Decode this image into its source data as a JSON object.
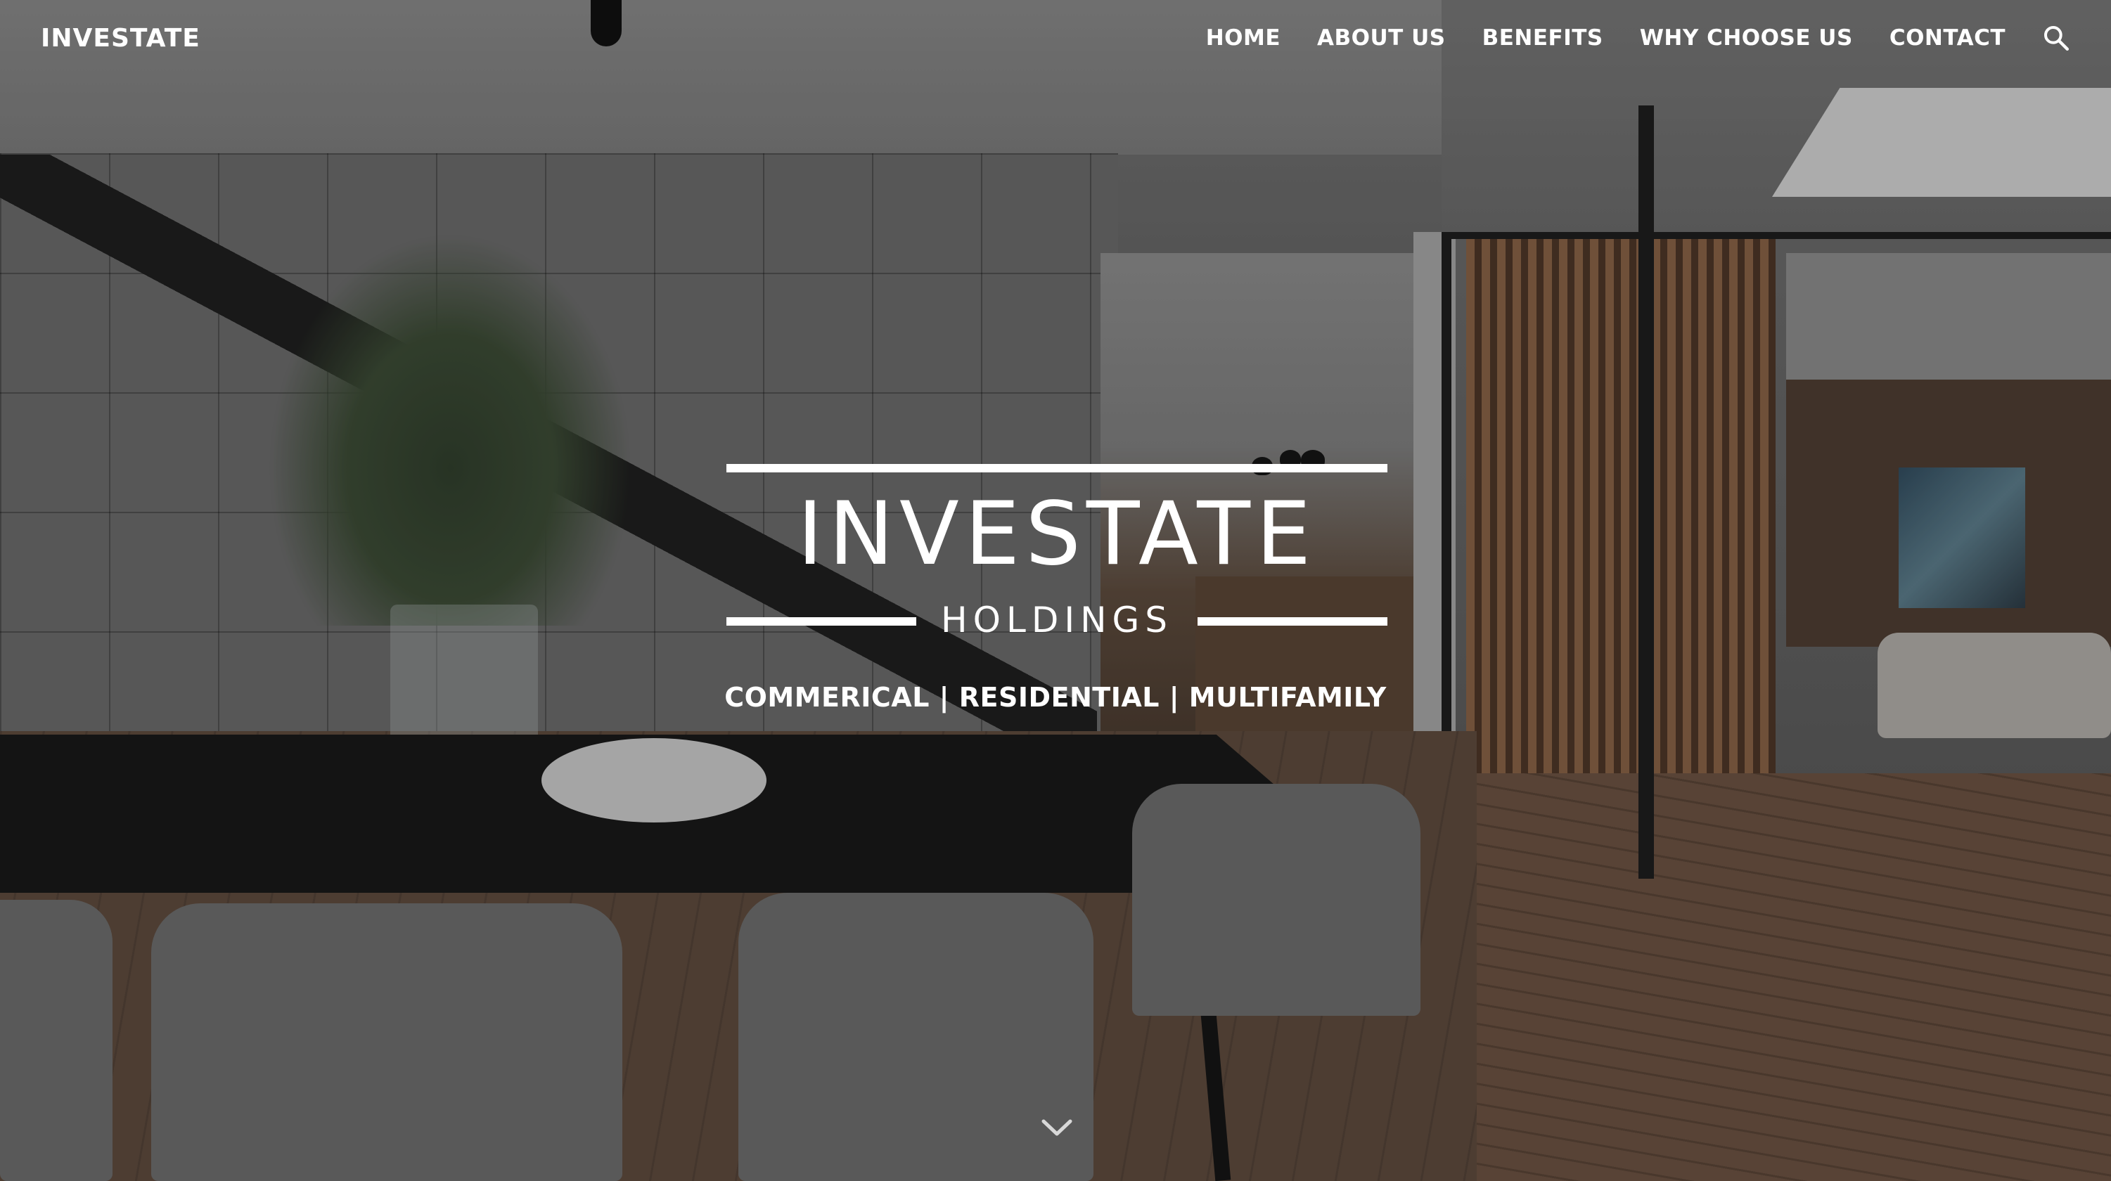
{
  "header": {
    "site_title": "INVESTATE",
    "nav": [
      {
        "label": "HOME"
      },
      {
        "label": "ABOUT US"
      },
      {
        "label": "BENEFITS"
      },
      {
        "label": "WHY CHOOSE US"
      },
      {
        "label": "CONTACT"
      }
    ],
    "search_icon": "search-icon"
  },
  "hero": {
    "logo_main": "INVESTATE",
    "logo_sub": "HOLDINGS",
    "tagline": "COMMERICAL | RESIDENTIAL | MULTIFAMILY",
    "scroll_icon": "chevron-down-icon"
  },
  "colors": {
    "text": "#ffffff",
    "overlay": "#141414"
  }
}
